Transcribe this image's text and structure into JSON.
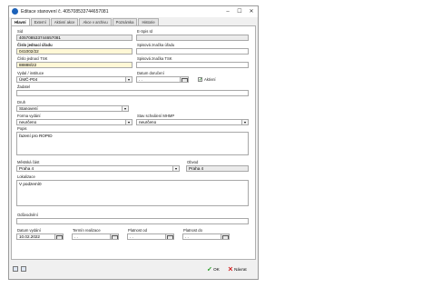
{
  "window": {
    "title": "Editace stanovení č. 405708533744657081"
  },
  "tabs": [
    "Hlavní",
    "Externí",
    "Aktivní akce",
    "Akce v archivu",
    "Poznámka",
    "Historie"
  ],
  "fields": {
    "sid": {
      "label": "Sid",
      "value": "405708533744657081"
    },
    "espis": {
      "label": "E-Spis Id",
      "value": ""
    },
    "cislo_jednaci": {
      "label": "Číslo jednací úřadu",
      "value": "041002/22"
    },
    "spisova_znacka_uradu": {
      "label": "Spisová značka úřadu",
      "value": ""
    },
    "cislo_jednaci_tsk": {
      "label": "Číslo jednací TSK",
      "value": "88888/22"
    },
    "spisova_znacka_tsk": {
      "label": "Spisová značka TSK",
      "value": ""
    },
    "vydal": {
      "label": "Vydal / instituce",
      "value": "ÚMČ-P04"
    },
    "datum_doruceni": {
      "label": "Datum doručení",
      "value": ". ."
    },
    "aktivni": {
      "label": "Aktivní",
      "checked": true
    },
    "zadatel": {
      "label": "Žadatel",
      "value": ""
    },
    "druh": {
      "label": "Druh",
      "value": "Stanovení"
    },
    "forma_vydani": {
      "label": "Forma vydání",
      "value": "neurčeno"
    },
    "stav_schvaleni": {
      "label": "Stav schválení MHMP",
      "value": "neurčeno"
    },
    "popis": {
      "label": "Popis",
      "value": "řazení pro ROPID"
    },
    "mestska_cast": {
      "label": "Městská část",
      "value": "Praha 4"
    },
    "obvod": {
      "label": "Obvod",
      "value": "Praha 4"
    },
    "lokalizace": {
      "label": "Lokalizace",
      "value": "V podzemí0"
    },
    "oduvodneni": {
      "label": "Odůvodnění",
      "value": ""
    },
    "datum_vydani": {
      "label": "Datum vydání",
      "value": "10.02.2022"
    },
    "termin_realizace": {
      "label": "Termín realizace",
      "value": ". ."
    },
    "platnost_od": {
      "label": "Platnost od",
      "value": ". ."
    },
    "platnost_do": {
      "label": "Platnost do",
      "value": ". ."
    }
  },
  "footer": {
    "ok_label": "OK",
    "cancel_label": "Návrat"
  },
  "icons": {
    "window": "app-icon",
    "calendar": "calendar-icon",
    "dropdown": "chevron-down-icon"
  }
}
